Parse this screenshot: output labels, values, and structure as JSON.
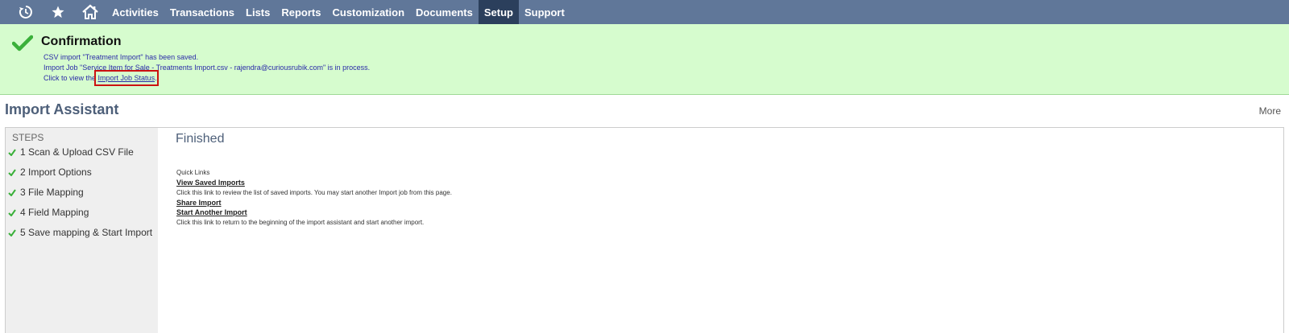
{
  "nav": {
    "icons": [
      "recent-history-icon",
      "star-icon",
      "home-icon"
    ],
    "items": [
      {
        "label": "Activities",
        "active": false
      },
      {
        "label": "Transactions",
        "active": false
      },
      {
        "label": "Lists",
        "active": false
      },
      {
        "label": "Reports",
        "active": false
      },
      {
        "label": "Customization",
        "active": false
      },
      {
        "label": "Documents",
        "active": false
      },
      {
        "label": "Setup",
        "active": true
      },
      {
        "label": "Support",
        "active": false
      }
    ],
    "bar_color": "#607799",
    "active_color": "#2b3f5c"
  },
  "confirmation": {
    "title": "Confirmation",
    "line1": "CSV import \"Treatment Import\" has been saved.",
    "line2": "Import Job \"Service Item for Sale - Treatments Import.csv - rajendra@curiousrubik.com\" is in process.",
    "line3_prefix": "Click to view the ",
    "line3_link": "Import Job Status",
    "line3_suffix": ".",
    "icon": "checkmark-icon",
    "bg_color": "#d6fcce"
  },
  "page": {
    "title": "Import Assistant",
    "more_label": "More"
  },
  "steps": {
    "heading": "STEPS",
    "items": [
      {
        "label": "1 Scan & Upload CSV File",
        "done": true
      },
      {
        "label": "2 Import Options",
        "done": true
      },
      {
        "label": "3 File Mapping",
        "done": true
      },
      {
        "label": "4 Field Mapping",
        "done": true
      },
      {
        "label": "5 Save mapping & Start Import",
        "done": true
      }
    ]
  },
  "content": {
    "heading": "Finished",
    "quick_links_label": "Quick Links",
    "links": [
      {
        "label": "View Saved Imports",
        "desc": "Click this link to review the list of saved imports. You may start another Import job from this page."
      },
      {
        "label": "Share Import",
        "desc": ""
      },
      {
        "label": "Start Another Import",
        "desc": "Click this link to return to the beginning of the import assistant and start another import."
      }
    ]
  }
}
